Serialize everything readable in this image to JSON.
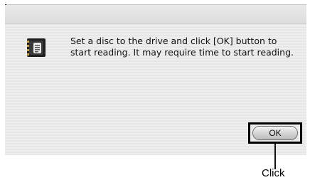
{
  "dialog": {
    "icon": "disc-reader-app-icon",
    "message": "Set a disc to the drive and click [OK] button to start reading. It may require time to start reading.",
    "ok_label": "OK"
  },
  "annotation": {
    "callout_label": "Click"
  },
  "colors": {
    "dialog_stripe_light": "#eeeeee",
    "dialog_stripe_dark": "#e6e6e6",
    "callout_outline": "#000000"
  }
}
